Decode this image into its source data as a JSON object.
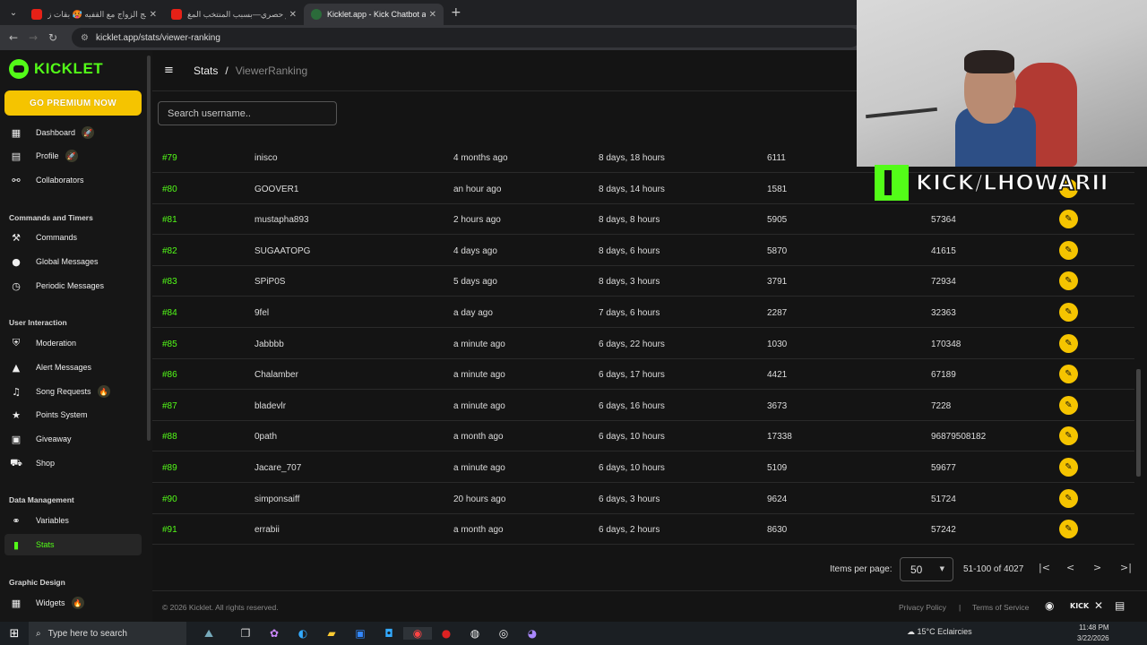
{
  "browser": {
    "tabs": [
      {
        "title": "برنامج الزواج مع القفيه 🥵 بقات ز...",
        "favicon": "youtube-icon",
        "active": false
      },
      {
        "title": "خبر حصري—بسبب المنتخب المغ...",
        "favicon": "youtube-icon",
        "active": false
      },
      {
        "title": "Kicklet.app - Kick Chatbot and ...",
        "favicon": "kicklet-icon",
        "active": true
      }
    ],
    "new_tab": "+",
    "url": "kicklet.app/stats/viewer-ranking"
  },
  "sidebar": {
    "logo": "KICKLET",
    "premium_label": "GO PREMIUM NOW",
    "items_top": [
      {
        "label": "Dashboard",
        "icon": "grid-icon",
        "badge": "🚀"
      },
      {
        "label": "Profile",
        "icon": "profile-icon",
        "badge": "🚀"
      },
      {
        "label": "Collaborators",
        "icon": "handshake-icon"
      }
    ],
    "sections": [
      {
        "title": "Commands and Timers",
        "items": [
          {
            "label": "Commands",
            "icon": "wrench-icon"
          },
          {
            "label": "Global Messages",
            "icon": "chat-bubble-icon"
          },
          {
            "label": "Periodic Messages",
            "icon": "clock-icon"
          }
        ]
      },
      {
        "title": "User Interaction",
        "items": [
          {
            "label": "Moderation",
            "icon": "shield-icon"
          },
          {
            "label": "Alert Messages",
            "icon": "warning-icon"
          },
          {
            "label": "Song Requests",
            "icon": "music-note-icon",
            "badge": "🔥"
          },
          {
            "label": "Points System",
            "icon": "star-icon"
          },
          {
            "label": "Giveaway",
            "icon": "gift-icon"
          },
          {
            "label": "Shop",
            "icon": "cart-icon"
          }
        ]
      },
      {
        "title": "Data Management",
        "items": [
          {
            "label": "Variables",
            "icon": "link-icon"
          },
          {
            "label": "Stats",
            "icon": "bar-chart-icon",
            "active": true
          }
        ]
      },
      {
        "title": "Graphic Design",
        "items": [
          {
            "label": "Widgets",
            "icon": "widgets-icon",
            "badge": "🔥"
          }
        ]
      }
    ]
  },
  "breadcrumb": {
    "parent": "Stats",
    "sep": "/",
    "current": "ViewerRanking"
  },
  "search": {
    "placeholder": "Search username.."
  },
  "rows": [
    {
      "rank": "#79",
      "user": "inisco",
      "last_seen": "4 months ago",
      "watchtime": "8 days, 18 hours",
      "messages": "6111",
      "points": ""
    },
    {
      "rank": "#80",
      "user": "GOOVER1",
      "last_seen": "an hour ago",
      "watchtime": "8 days, 14 hours",
      "messages": "1581",
      "points": ""
    },
    {
      "rank": "#81",
      "user": "mustapha893",
      "last_seen": "2 hours ago",
      "watchtime": "8 days, 8 hours",
      "messages": "5905",
      "points": "57364"
    },
    {
      "rank": "#82",
      "user": "SUGAATOPG",
      "last_seen": "4 days ago",
      "watchtime": "8 days, 6 hours",
      "messages": "5870",
      "points": "41615"
    },
    {
      "rank": "#83",
      "user": "SPiP0S",
      "last_seen": "5 days ago",
      "watchtime": "8 days, 3 hours",
      "messages": "3791",
      "points": "72934"
    },
    {
      "rank": "#84",
      "user": "9fel",
      "last_seen": "a day ago",
      "watchtime": "7 days, 6 hours",
      "messages": "2287",
      "points": "32363"
    },
    {
      "rank": "#85",
      "user": "Jabbbb",
      "last_seen": "a minute ago",
      "watchtime": "6 days, 22 hours",
      "messages": "1030",
      "points": "170348"
    },
    {
      "rank": "#86",
      "user": "Chalamber",
      "last_seen": "a minute ago",
      "watchtime": "6 days, 17 hours",
      "messages": "4421",
      "points": "67189"
    },
    {
      "rank": "#87",
      "user": "bladevlr",
      "last_seen": "a minute ago",
      "watchtime": "6 days, 16 hours",
      "messages": "3673",
      "points": "7228"
    },
    {
      "rank": "#88",
      "user": "0path",
      "last_seen": "a month ago",
      "watchtime": "6 days, 10 hours",
      "messages": "17338",
      "points": "96879508182"
    },
    {
      "rank": "#89",
      "user": "Jacare_707",
      "last_seen": "a minute ago",
      "watchtime": "6 days, 10 hours",
      "messages": "5109",
      "points": "59677"
    },
    {
      "rank": "#90",
      "user": "simponsaiff",
      "last_seen": "20 hours ago",
      "watchtime": "6 days, 3 hours",
      "messages": "9624",
      "points": "51724"
    },
    {
      "rank": "#91",
      "user": "errabii",
      "last_seen": "a month ago",
      "watchtime": "6 days, 2 hours",
      "messages": "8630",
      "points": "57242"
    }
  ],
  "pagination": {
    "label": "Items per page:",
    "per_page": "50",
    "range": "51-100 of 4027"
  },
  "footer": {
    "copyright": "© 2026 Kicklet. All rights reserved.",
    "privacy": "Privacy Policy",
    "sep": "|",
    "terms": "Terms of Service",
    "kick_label": "KICK"
  },
  "overlay": {
    "text": "KICK/LHOWARII"
  },
  "taskbar": {
    "search_placeholder": "Type here to search",
    "temperature": "15°C",
    "weather": "Eclaircies",
    "time": "11:48 PM",
    "date": "3/22/2026"
  },
  "colors": {
    "accent": "#53fc18",
    "premium": "#f5c400",
    "background": "#141414"
  }
}
